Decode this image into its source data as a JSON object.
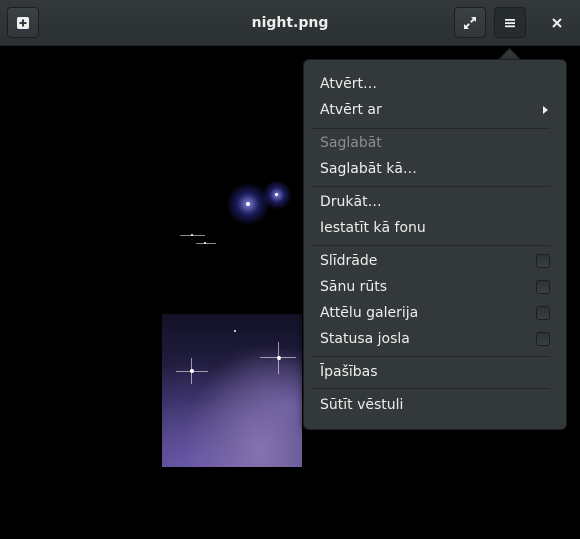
{
  "window": {
    "title": "night.png"
  },
  "headerbar": {
    "new_icon": "plus-square-icon",
    "fullscreen_icon": "fullscreen-icon",
    "menu_icon": "hamburger-menu-icon",
    "close_icon": "close-icon"
  },
  "menu": {
    "open": "Atvērt…",
    "open_with": "Atvērt ar",
    "save": "Saglabāt",
    "save_as": "Saglabāt kā…",
    "print": "Drukāt…",
    "set_background": "Iestatīt kā fonu",
    "slideshow": "Slīdrāde",
    "side_pane": "Sānu rūts",
    "gallery": "Attēlu galerija",
    "statusbar": "Statusa josla",
    "properties": "Īpašības",
    "send_email": "Sūtīt vēstuli"
  },
  "toggles": {
    "slideshow": false,
    "side_pane": false,
    "gallery": false,
    "statusbar": false
  },
  "colors": {
    "headerbar": "#2f3537",
    "popover": "#33393b",
    "text": "#eeeeec",
    "disabled": "#8b8e8f"
  }
}
